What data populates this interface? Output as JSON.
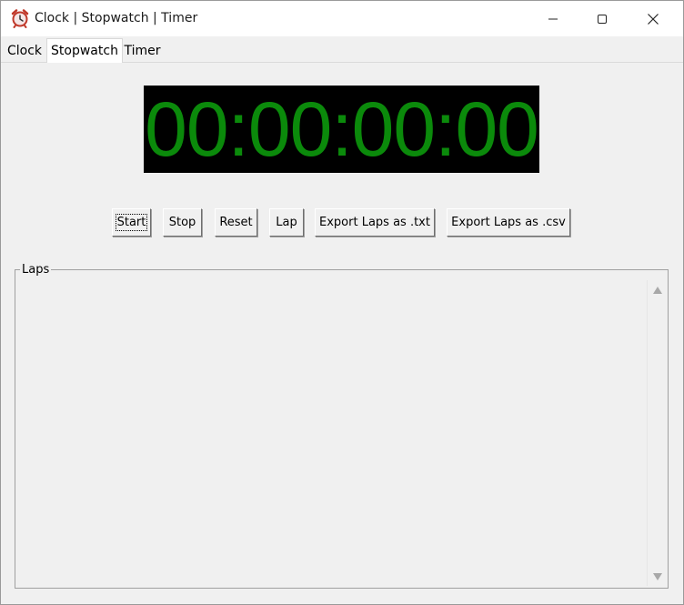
{
  "window": {
    "title": "Clock | Stopwatch | Timer",
    "icon": "alarm-clock-icon",
    "controls": {
      "minimize": "minimize-icon",
      "maximize": "maximize-icon",
      "close": "close-icon"
    }
  },
  "tabs": [
    {
      "label": "Clock",
      "selected": false
    },
    {
      "label": "Stopwatch",
      "selected": true
    },
    {
      "label": "Timer",
      "selected": false
    }
  ],
  "stopwatch": {
    "display": "00:00:00:00",
    "display_color": "#0b8a0b",
    "display_background": "#000000",
    "buttons": {
      "start": "Start",
      "stop": "Stop",
      "reset": "Reset",
      "lap": "Lap",
      "export_txt": "Export Laps as .txt",
      "export_csv": "Export Laps as .csv"
    },
    "laps": {
      "label": "Laps",
      "items": []
    }
  }
}
